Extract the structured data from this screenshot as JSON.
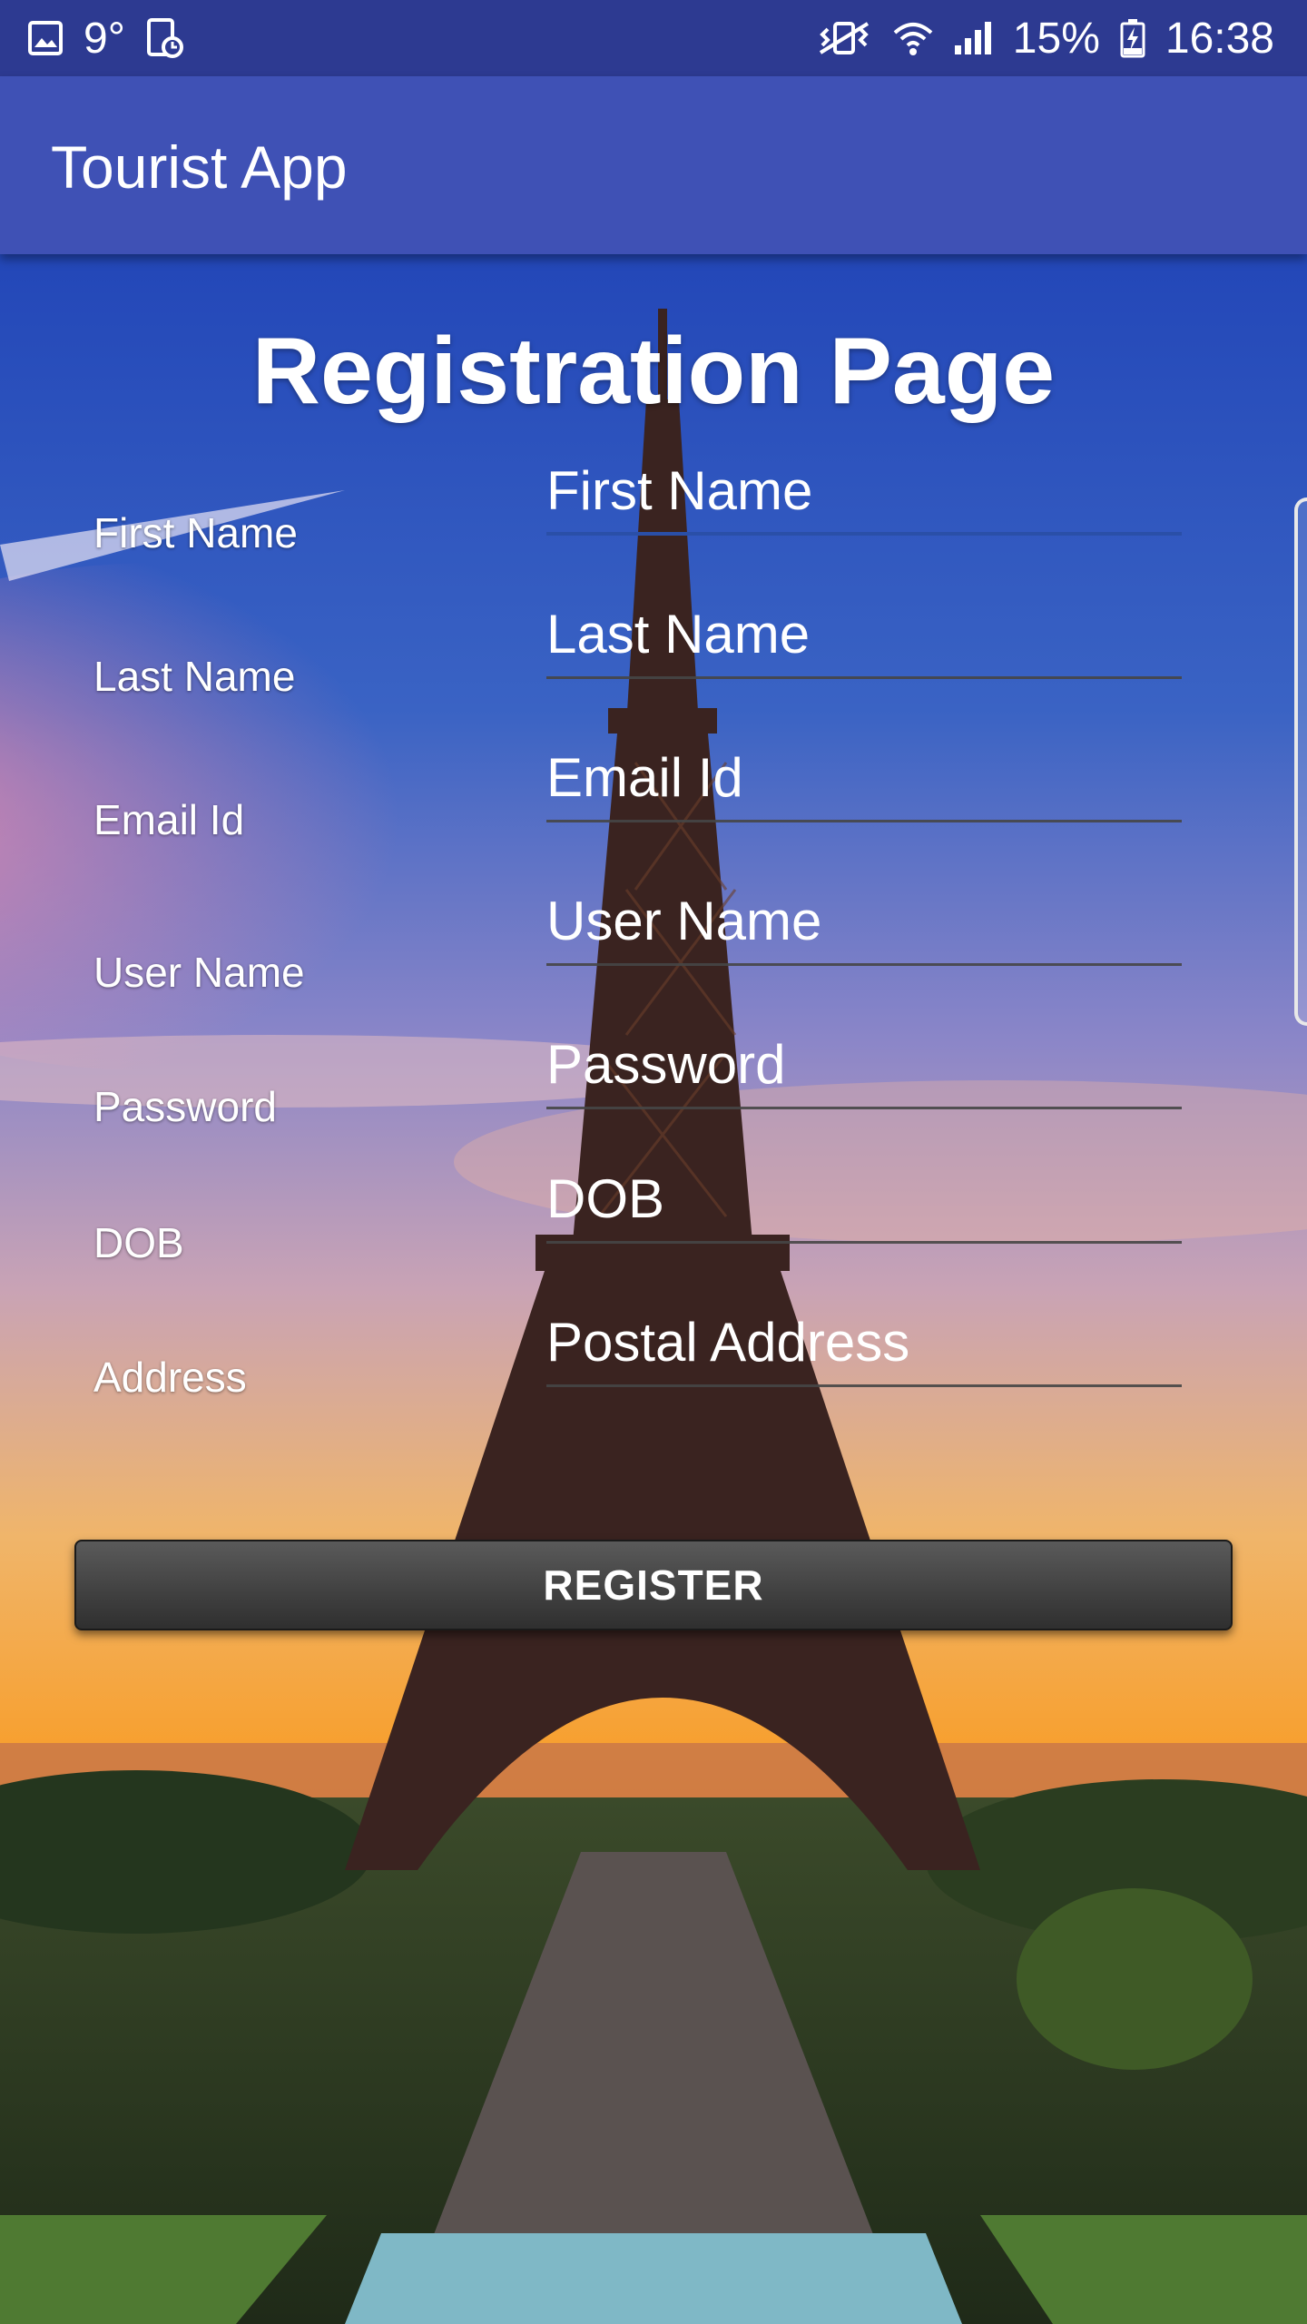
{
  "status_bar": {
    "temperature": "9°",
    "battery": "15%",
    "time": "16:38"
  },
  "app_bar": {
    "title": "Tourist App"
  },
  "form": {
    "heading": "Registration Page",
    "labels": [
      "First Name",
      "Last Name",
      "Email Id",
      "User Name",
      "Password",
      "DOB",
      "Address"
    ],
    "placeholders": {
      "first_name": "First Name",
      "last_name": "Last Name",
      "email": "Email Id",
      "username": "User Name",
      "password": "Password",
      "dob": "DOB",
      "address": "Postal Address"
    },
    "register_label": "REGISTER"
  },
  "colors": {
    "status_bar": "#2d3a91",
    "app_bar": "#3f51b5",
    "active_underline": "#2a4fa8",
    "button": "#3c3c3c"
  }
}
